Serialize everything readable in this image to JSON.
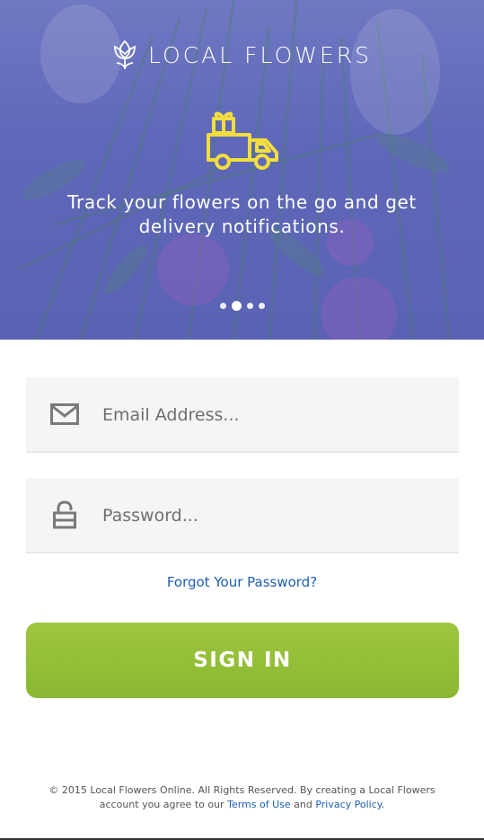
{
  "hero": {
    "logo_text": "LOCAL FLOWERS",
    "tagline": "Track your flowers on the go and get delivery notifications.",
    "carousel_active_index": 1,
    "carousel_total": 4,
    "accent_color": "#f2dd3e"
  },
  "form": {
    "email_placeholder": "Email Address...",
    "password_placeholder": "Password...",
    "forgot_label": "Forgot Your Password?",
    "signin_label": "SIGN IN"
  },
  "footer": {
    "text_part1": "© 2015 Local Flowers Online. All Rights Reserved. By creating a Local Flowers account you agree to our ",
    "terms_label": "Terms of Use",
    "and_text": " and ",
    "privacy_label": "Privacy Policy",
    "end_text": "."
  },
  "colors": {
    "hero_overlay": "#5e67b8",
    "signin_green": "#8ab832",
    "link_blue": "#1d5fb5"
  }
}
